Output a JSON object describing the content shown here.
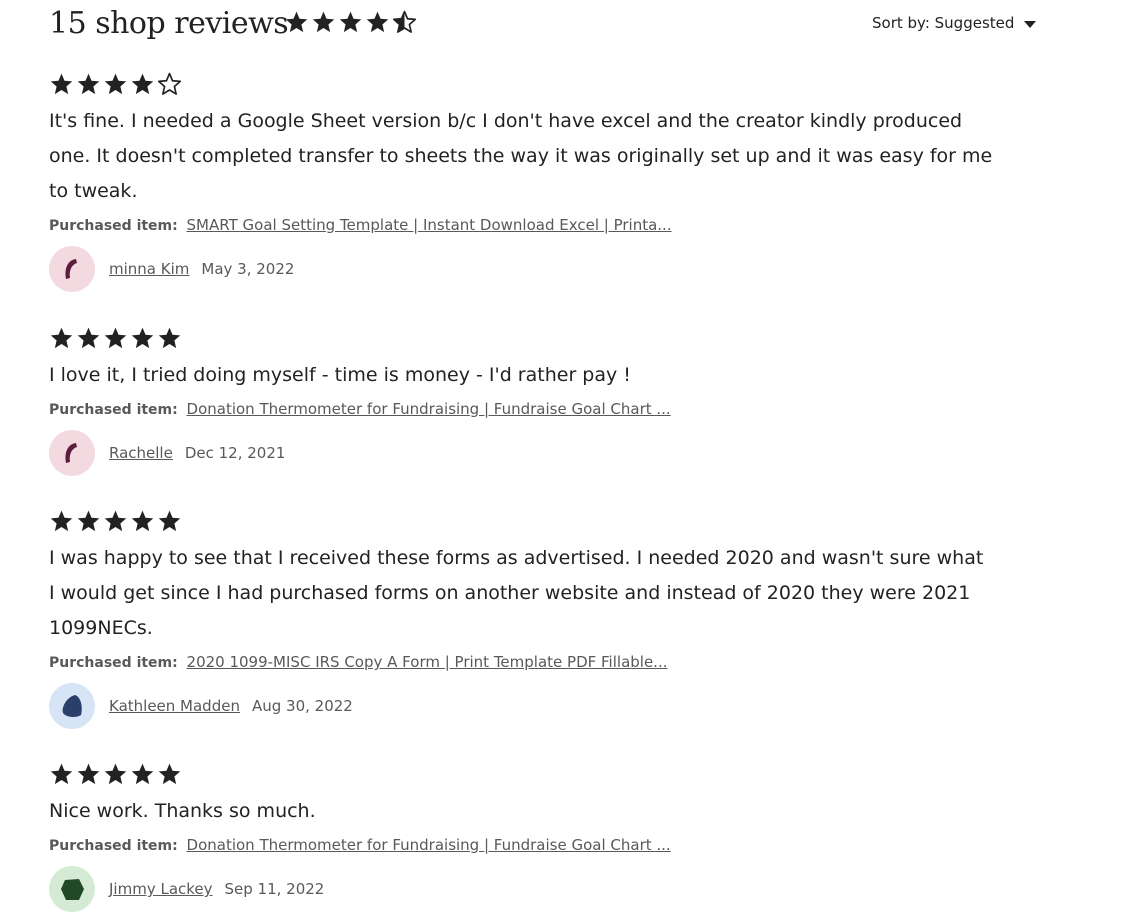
{
  "header": {
    "title": "15 shop reviews",
    "rating": 4.5,
    "sort_label": "Sort by: Suggested"
  },
  "colors": {
    "text": "#222222",
    "muted": "#595959",
    "star": "#222222",
    "avatar_pink_bg": "#f3d9e0",
    "avatar_pink_fg": "#5a1f3e",
    "avatar_blue_bg": "#d6e4f5",
    "avatar_blue_fg": "#2b3f6b",
    "avatar_green_bg": "#d5ead4",
    "avatar_green_fg": "#1f4a25"
  },
  "purchased_label": "Purchased item:",
  "reviews": [
    {
      "rating": 4,
      "text": "It's fine. I needed a Google Sheet version b/c I don't have excel and the creator kindly produced one. It doesn't completed transfer to sheets the way it was originally set up and it was easy for me to tweak.",
      "item": "SMART Goal Setting Template | Instant Download Excel | Printa...",
      "author": "minna Kim",
      "date": "May 3, 2022",
      "avatar_icon": "crescent-icon"
    },
    {
      "rating": 5,
      "text": "I love it, I tried doing myself - time is money - I'd rather pay !",
      "item": "Donation Thermometer for Fundraising | Fundraise Goal Chart ...",
      "author": "Rachelle",
      "date": "Dec 12, 2021",
      "avatar_icon": "crescent-icon"
    },
    {
      "rating": 5,
      "text": "I was happy to see that I received these forms as advertised. I needed 2020 and wasn't sure what I would get since I had purchased forms on another website and instead of 2020 they were 2021 1099NECs.",
      "item": "2020 1099-MISC IRS Copy A Form | Print Template PDF Fillable...",
      "author": "Kathleen Madden",
      "date": "Aug 30, 2022",
      "avatar_icon": "pebble-icon"
    },
    {
      "rating": 5,
      "text": "Nice work. Thanks so much.",
      "item": "Donation Thermometer for Fundraising | Fundraise Goal Chart ...",
      "author": "Jimmy Lackey",
      "date": "Sep 11, 2022",
      "avatar_icon": "hexagon-icon"
    }
  ]
}
